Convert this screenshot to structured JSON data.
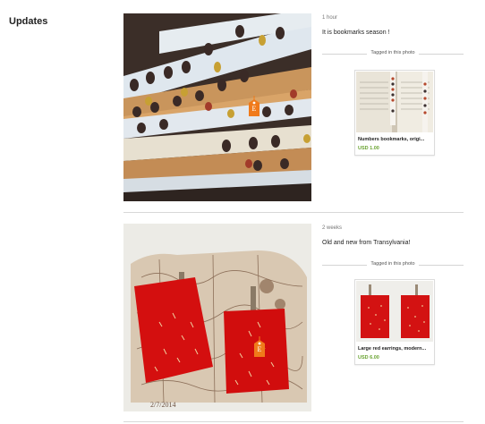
{
  "page": {
    "section_title": "Updates"
  },
  "posts": [
    {
      "time": "1 hour",
      "caption": "It is bookmarks season !",
      "tagged_label": "Tagged in this photo",
      "item": {
        "name": "Numbers bookmarks, origi...",
        "price": "USD 1.00"
      },
      "tag_letter": "E"
    },
    {
      "time": "2 weeks",
      "caption": "Old and new from Transylvania!",
      "tagged_label": "Tagged in this photo",
      "item": {
        "name": "Large red earrings, modern...",
        "price": "USD 6.00"
      },
      "tag_letter": "E"
    }
  ],
  "colors": {
    "price": "#6aa332",
    "etsy_tag": "#f07a1a"
  }
}
